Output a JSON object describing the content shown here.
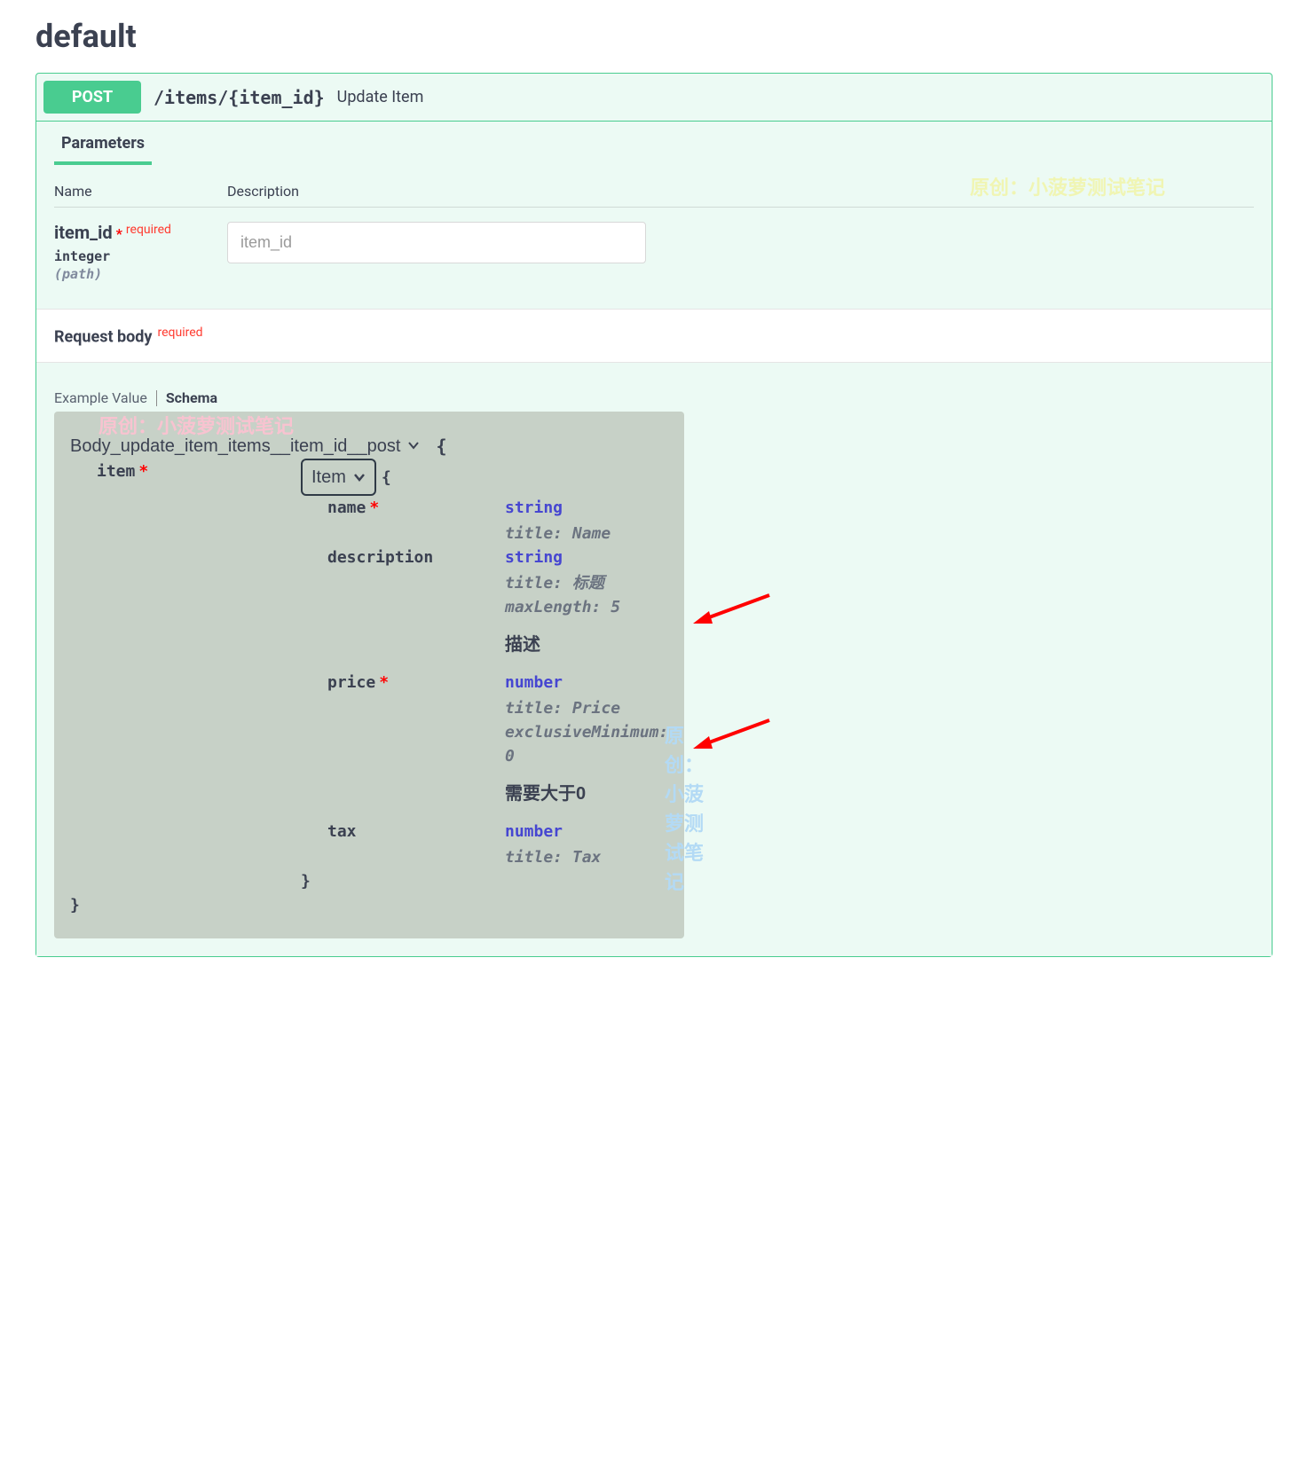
{
  "section_title": "default",
  "operation": {
    "method": "POST",
    "path": "/items/{item_id}",
    "summary": "Update Item"
  },
  "tabs": {
    "parameters": "Parameters"
  },
  "watermarks": {
    "w1": "原创：小菠萝测试笔记",
    "w2": "原创：小菠萝测试笔记",
    "w3": "原创：小菠萝测试笔记"
  },
  "table_headers": {
    "name": "Name",
    "description": "Description"
  },
  "param": {
    "name": "item_id",
    "required_label": "required",
    "type": "integer",
    "in": "(path)",
    "placeholder": "item_id"
  },
  "request_body": {
    "title": "Request body",
    "required_label": "required"
  },
  "schema_tabs": {
    "example": "Example Value",
    "schema": "Schema"
  },
  "schema": {
    "title": "Body_update_item_items__item_id__post",
    "item_prop": "item",
    "item_model": "Item",
    "fields": {
      "name": {
        "label": "name",
        "type": "string",
        "title": "title: Name"
      },
      "description": {
        "label": "description",
        "type": "string",
        "title": "title: 标题",
        "maxlen": "maxLength: 5",
        "desc": "描述"
      },
      "price": {
        "label": "price",
        "type": "number",
        "title": "title: Price",
        "exmin": "exclusiveMinimum: 0",
        "desc": "需要大于0"
      },
      "tax": {
        "label": "tax",
        "type": "number",
        "title": "title: Tax"
      }
    }
  }
}
